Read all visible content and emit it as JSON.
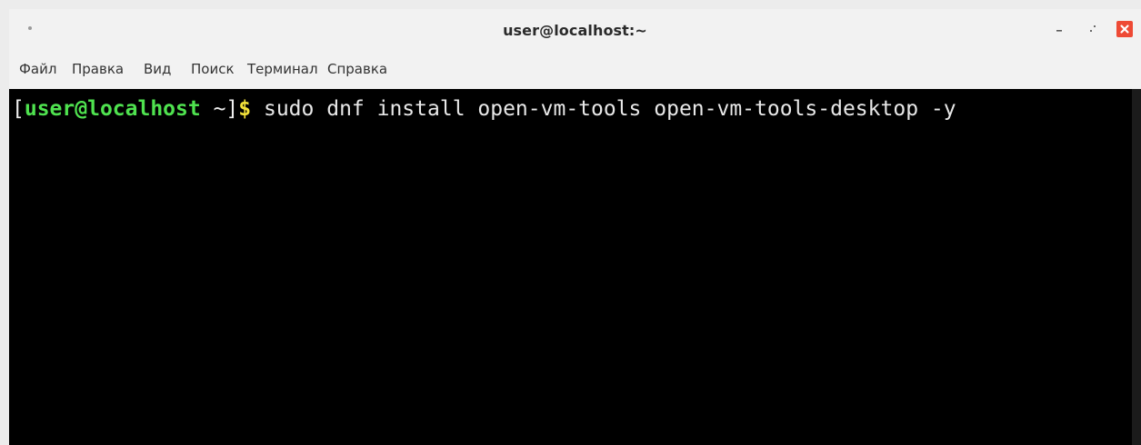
{
  "window": {
    "title": "user@localhost:~",
    "controls": {
      "minimize_icon": "minimize-icon",
      "maximize_icon": "maximize-icon",
      "close_icon": "close-icon",
      "close_color": "#ee4a35"
    }
  },
  "menubar": {
    "items": [
      {
        "label": "Файл"
      },
      {
        "label": "Правка"
      },
      {
        "label": "Вид"
      },
      {
        "label": "Поиск"
      },
      {
        "label": "Терминал"
      },
      {
        "label": "Справка"
      }
    ]
  },
  "terminal": {
    "background": "#000000",
    "prompt": {
      "open_bracket": "[",
      "user_host": "user@localhost",
      "dir": " ~]",
      "sign": "$",
      "user_host_color": "#4fe24f",
      "sign_color": "#f3e23a"
    },
    "command": " sudo dnf install open-vm-tools open-vm-tools-desktop -y"
  }
}
